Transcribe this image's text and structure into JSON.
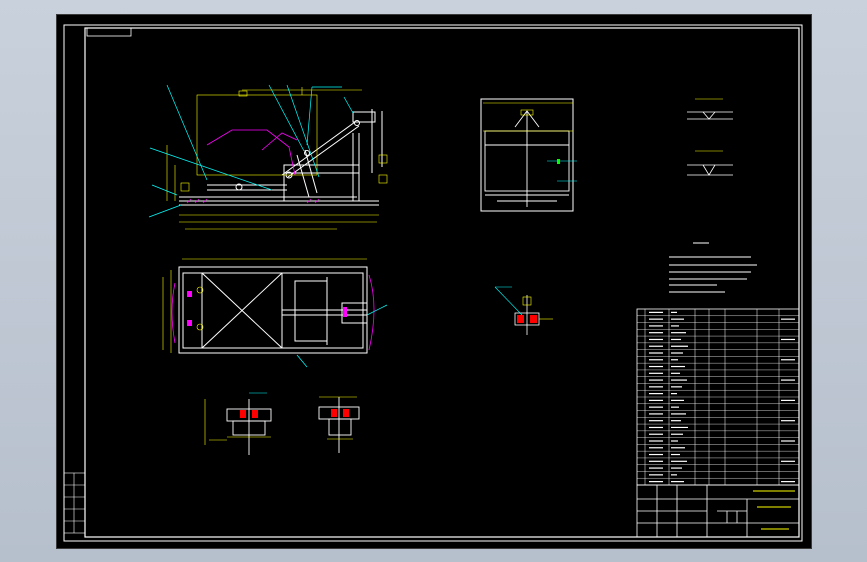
{
  "app": {
    "view": "cad-drawing-viewport"
  },
  "colors": {
    "background": "#000000",
    "frame": "#ffffff",
    "geometry": "#ffffff",
    "dimension": "#ffff00",
    "leader": "#00ffff",
    "section": "#ff0000",
    "hatch": "#ff00ff",
    "bolt": "#00ff00",
    "title_text": "#ffff00"
  },
  "drawing": {
    "views": [
      "side-elevation",
      "plan-view",
      "end-view",
      "section-detail-a",
      "section-detail-b",
      "bolt-detail",
      "weld-symbols"
    ],
    "technical_requirements": {
      "line_count": 6
    },
    "parts_list": {
      "row_count": 26
    },
    "title_block": {
      "present": true
    }
  }
}
